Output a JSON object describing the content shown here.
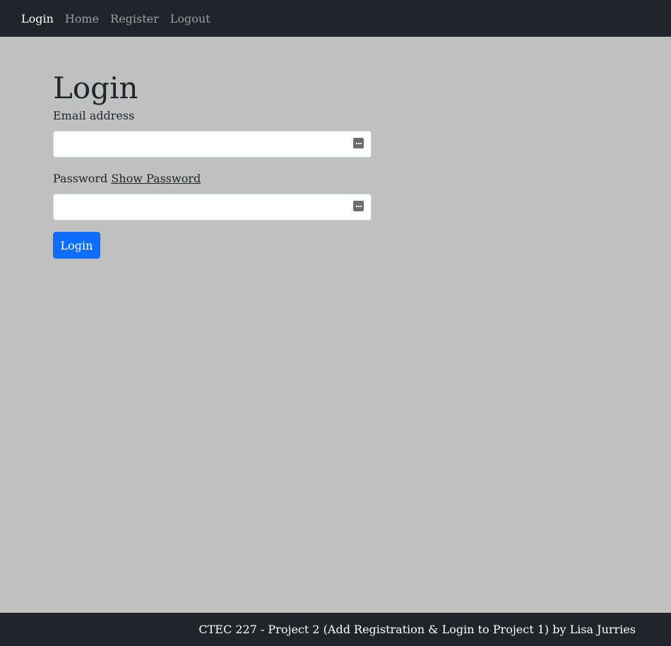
{
  "nav": {
    "items": [
      {
        "label": "Login",
        "active": true
      },
      {
        "label": "Home",
        "active": false
      },
      {
        "label": "Register",
        "active": false
      },
      {
        "label": "Logout",
        "active": false
      }
    ]
  },
  "main": {
    "title": "Login",
    "email": {
      "label": "Email address",
      "value": "",
      "placeholder": ""
    },
    "password": {
      "label": "Password",
      "show_label": "Show Password",
      "value": "",
      "placeholder": ""
    },
    "submit_label": "Login"
  },
  "footer": {
    "text": "CTEC 227 - Project 2 (Add Registration & Login to Project 1) by Lisa Jurries"
  },
  "colors": {
    "navbar_bg": "#212529",
    "page_bg": "#c0c0c0",
    "primary": "#0d6efd"
  },
  "icons": {
    "field_icon": "password-manager-icon"
  }
}
